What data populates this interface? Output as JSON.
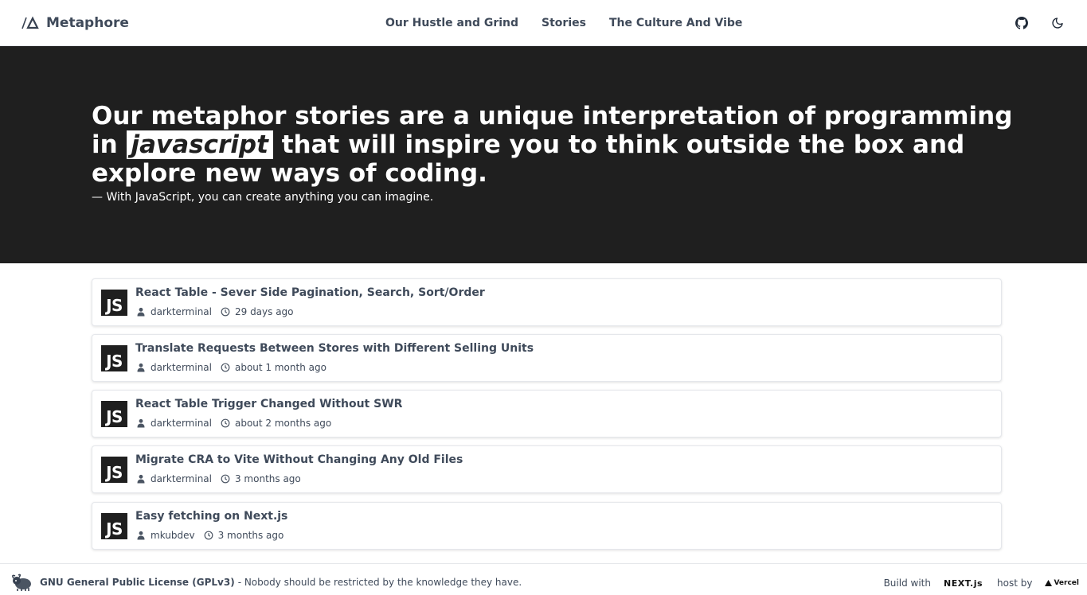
{
  "header": {
    "brand": "Metaphore",
    "nav": [
      "Our Hustle and Grind",
      "Stories",
      "The Culture And Vibe"
    ],
    "github_icon": "github-icon",
    "theme_icon": "moon-icon"
  },
  "hero": {
    "before": "Our metaphor stories are a unique interpretation of programming in",
    "highlight": "javascript",
    "after": " that will inspire you to think outside the box and explore new ways of coding.",
    "quote": "— With JavaScript, you can create anything you can imagine."
  },
  "stories": [
    {
      "badge": "JS",
      "title": "React Table - Sever Side Pagination, Search, Sort/Order",
      "author": "darkterminal",
      "time": "29 days ago"
    },
    {
      "badge": "JS",
      "title": "Translate Requests Between Stores with Different Selling Units",
      "author": "darkterminal",
      "time": "about 1 month ago"
    },
    {
      "badge": "JS",
      "title": "React Table Trigger Changed Without SWR",
      "author": "darkterminal",
      "time": "about 2 months ago"
    },
    {
      "badge": "JS",
      "title": "Migrate CRA to Vite Without Changing Any Old Files",
      "author": "darkterminal",
      "time": "3 months ago"
    },
    {
      "badge": "JS",
      "title": "Easy fetching on Next.js",
      "author": "mkubdev",
      "time": "3 months ago"
    }
  ],
  "footer": {
    "license": "GNU General Public License (GPLv3)",
    "tagline": "- Nobody should be restricted by the knowledge they have.",
    "build_label": "Build with",
    "next_logo": "NEXT.js",
    "host_label": "host by",
    "vercel_logo": "Vercel"
  }
}
